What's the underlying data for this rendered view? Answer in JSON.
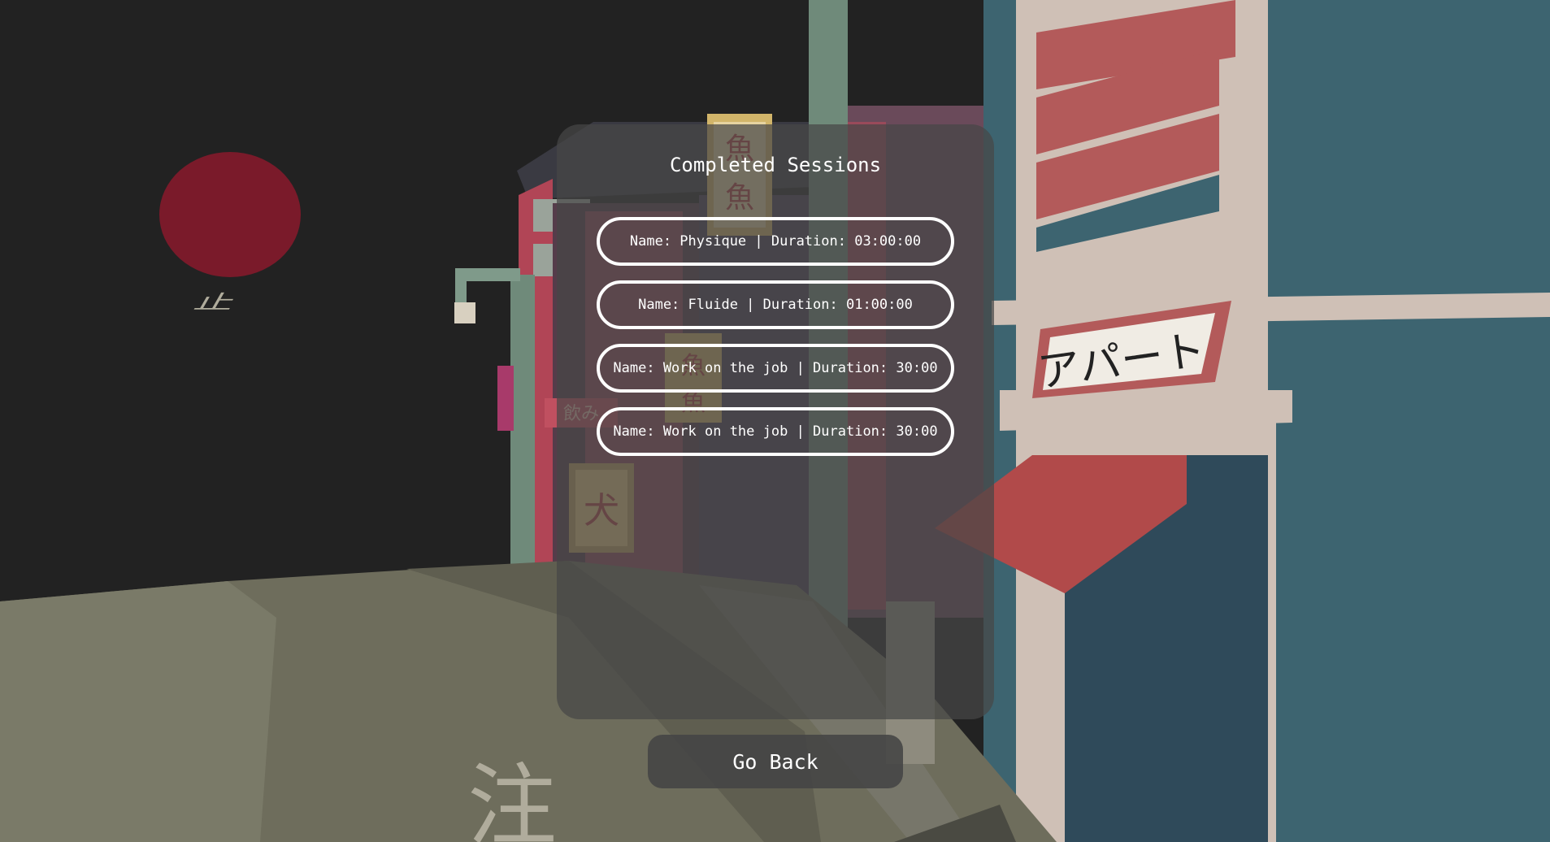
{
  "screen": {
    "title": "Completed Sessions",
    "sessions": [
      {
        "label": "Name: Physique | Duration: 03:00:00"
      },
      {
        "label": "Name: Fluide | Duration: 01:00:00"
      },
      {
        "label": "Name: Work on the job | Duration: 30:00"
      },
      {
        "label": "Name: Work on the job | Duration: 30:00"
      }
    ],
    "back_label": "Go Back"
  },
  "background": {
    "sign_apart": "アパート",
    "sign_fish_1": "魚",
    "sign_fish_2": "魚",
    "sign_fish_3": "魚",
    "sign_fish_4": "魚",
    "sign_dog": "犬",
    "sign_drink": "飲み",
    "road_marking_1": "止",
    "road_marking_2": "注"
  },
  "colors": {
    "sky": "#222222",
    "moon": "#7a1a2a",
    "text": "#ffffff",
    "teal_building": "#3d6470",
    "salmon_stripe": "#b35a5a",
    "road": "#6e6d5c"
  }
}
